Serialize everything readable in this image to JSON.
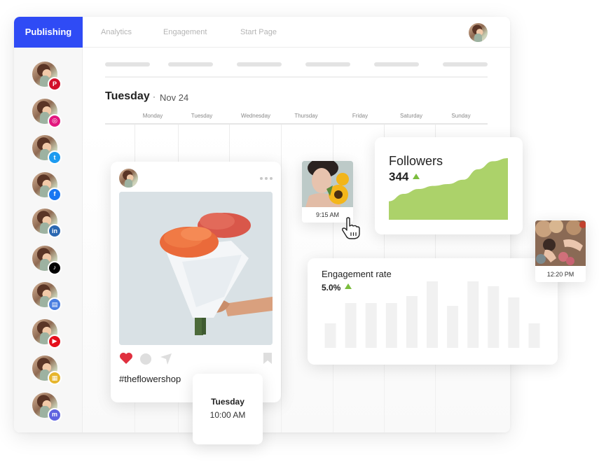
{
  "topbar": {
    "tabs": [
      {
        "label": "Publishing",
        "active": true
      },
      {
        "label": "Analytics",
        "active": false
      },
      {
        "label": "Engagement",
        "active": false
      },
      {
        "label": "Start Page",
        "active": false
      }
    ],
    "accent_color": "#2f4bf5"
  },
  "sidebar": {
    "accounts": [
      {
        "network": "pinterest",
        "icon": "pinterest-icon",
        "color": "#d2102a",
        "glyph": "P"
      },
      {
        "network": "instagram",
        "icon": "instagram-icon",
        "color": "#e2187f",
        "glyph": "◎"
      },
      {
        "network": "twitter",
        "icon": "twitter-icon",
        "color": "#1d9bf0",
        "glyph": "t"
      },
      {
        "network": "facebook",
        "icon": "facebook-icon",
        "color": "#1877f2",
        "glyph": "f"
      },
      {
        "network": "linkedin",
        "icon": "linkedin-icon",
        "color": "#2a67b1",
        "glyph": "in"
      },
      {
        "network": "tiktok",
        "icon": "tiktok-icon",
        "color": "#000000",
        "glyph": "♪"
      },
      {
        "network": "google-business",
        "icon": "google-business-icon",
        "color": "#4a7fe0",
        "glyph": "▤"
      },
      {
        "network": "youtube",
        "icon": "youtube-icon",
        "color": "#e5101c",
        "glyph": "▶"
      },
      {
        "network": "start-page",
        "icon": "start-page-icon",
        "color": "#e6b52c",
        "glyph": "▦"
      },
      {
        "network": "mastodon",
        "icon": "mastodon-icon",
        "color": "#5f64e0",
        "glyph": "m"
      }
    ]
  },
  "calendar": {
    "day": "Tuesday",
    "separator": "·",
    "date": "Nov 24",
    "weekdays": [
      "Monday",
      "Tuesday",
      "Wednesday",
      "Thursday",
      "Friday",
      "Saturday",
      "Sunday"
    ]
  },
  "post": {
    "hashtag": "#theflowershop",
    "liked": true,
    "like_color": "#e0303f"
  },
  "schedule": {
    "day": "Tuesday",
    "time": "10:00 AM"
  },
  "scheduled_thumbs": [
    {
      "time": "9:15 AM"
    },
    {
      "time": "12:20 PM"
    }
  ],
  "followers": {
    "title": "Followers",
    "value": "344",
    "trend": "up",
    "color": "#acd26a",
    "trend_color": "#7bbd3e",
    "curve": [
      0.3,
      0.42,
      0.5,
      0.55,
      0.58,
      0.65,
      0.82,
      0.95,
      1.0
    ]
  },
  "engagement": {
    "title": "Engagement rate",
    "value": "5.0%",
    "trend": "up",
    "bars": [
      0.35,
      0.64,
      0.64,
      0.64,
      0.74,
      0.95,
      0.6,
      0.95,
      0.88,
      0.72,
      0.35
    ],
    "bar_color": "#f1f1f1"
  }
}
